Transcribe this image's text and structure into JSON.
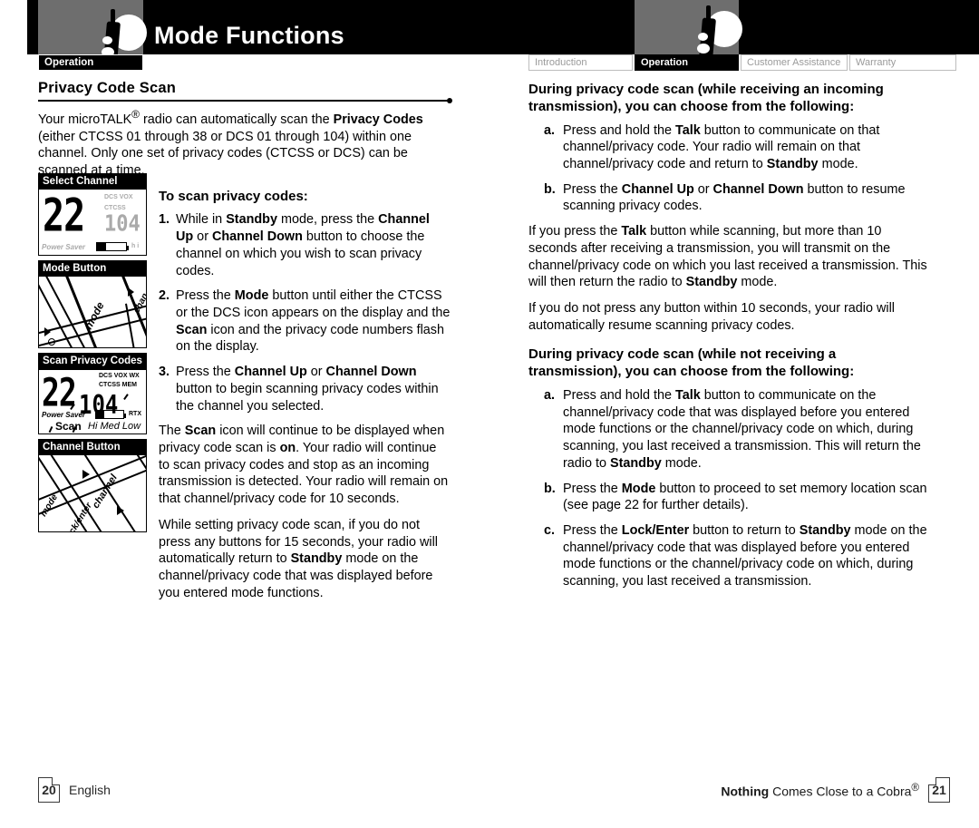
{
  "header": {
    "title": "Mode Functions",
    "left_tab": "Operation",
    "icon": "two-way-radio-icon",
    "right_tabs": [
      {
        "label": "Introduction",
        "active": false
      },
      {
        "label": "Operation",
        "active": true
      },
      {
        "label": "Customer Assistance",
        "active": false
      },
      {
        "label": "Warranty",
        "active": false
      }
    ]
  },
  "left_page": {
    "section_title": "Privacy Code Scan",
    "intro_html": "Your microTALK<sup>®</sup> radio can automatically scan the <b>Privacy Codes</b> (either CTCSS 01 through 38 or DCS 01 through 104) within one channel. Only one set of privacy codes (CTCSS or DCS) can be scanned at a time.",
    "subhead": "To scan privacy codes:",
    "steps": [
      {
        "marker": "1.",
        "html": "While in <b>Standby</b> mode, press the <b>Channel Up</b> or <b>Channel Down</b> button to choose the channel on which you wish to scan privacy codes."
      },
      {
        "marker": "2.",
        "html": "Press the <b>Mode</b> button until either the CTCSS or the DCS icon appears on the display and the <b>Scan</b> icon and the privacy code numbers flash on the display."
      },
      {
        "marker": "3.",
        "html": "Press the <b>Channel Up</b> or <b>Channel Down</b> button to begin scanning privacy codes within the channel you selected."
      }
    ],
    "note1_html": "The <b>Scan</b> icon will continue to be displayed when privacy code scan is <b>on</b>. Your radio will continue to scan privacy codes and stop as an incoming transmission is detected. Your radio will remain on that channel/privacy code for 10 seconds.",
    "note2_html": "While setting privacy code scan, if you do not press any buttons for 15 seconds, your radio will automatically return to <b>Standby</b> mode on the channel/privacy code that was displayed before you entered mode functions."
  },
  "figures": [
    {
      "caption": "Select Channel",
      "type": "lcd",
      "channel": "22",
      "code": "104",
      "indicators": [
        "DCS",
        "VOX",
        "CTCSS"
      ],
      "power_saver_label": "Power Saver"
    },
    {
      "caption": "Mode Button",
      "type": "keypad",
      "button_label": "mode",
      "secondary_label": "chan"
    },
    {
      "caption": "Scan Privacy Codes",
      "type": "lcd",
      "channel": "22",
      "code": "104",
      "indicators": [
        "DCS",
        "VOX",
        "WX",
        "CTCSS",
        "MEM",
        "RTX"
      ],
      "power_saver_label": "Power Saver",
      "scan_label": "Scan",
      "levels": "Hi Med Low"
    },
    {
      "caption": "Channel Button",
      "type": "keypad",
      "button_label": "channel",
      "secondary_label": "mode",
      "tertiary_label": "lock/enter"
    }
  ],
  "right_page": {
    "block1": {
      "heading": "During privacy code scan (while receiving an incoming transmission), you can choose from the following:",
      "items": [
        {
          "marker": "a.",
          "html": "Press and hold the <b>Talk</b> button to communicate on that channel/privacy code. Your radio will remain on that channel/privacy code and return to <b>Standby</b> mode."
        },
        {
          "marker": "b.",
          "html": "Press the <b>Channel Up</b> or <b>Channel Down</b> button to resume scanning privacy codes."
        }
      ]
    },
    "para1_html": "If you press the <b>Talk</b> button while scanning, but more than 10 seconds after receiving a transmission, you will transmit on the channel/privacy code on which you last received a transmission. This will then return the radio to <b>Standby</b> mode.",
    "para2_html": "If you do not press any button within 10 seconds, your radio will automatically resume scanning privacy codes.",
    "block2": {
      "heading": "During privacy code scan (while not receiving a transmission), you can choose from the following:",
      "items": [
        {
          "marker": "a.",
          "html": "Press and hold the <b>Talk</b> button to communicate on the channel/privacy code that was displayed before you entered mode functions or the channel/privacy code on which, during scanning, you last received a transmission. This will return the radio to <b>Standby</b> mode."
        },
        {
          "marker": "b.",
          "html": "Press the <b>Mode</b> button to proceed to set memory location scan (see page 22 for further details)."
        },
        {
          "marker": "c.",
          "html": "Press the <b>Lock/Enter</b> button to return to <b>Standby</b> mode on the channel/privacy code that was displayed before you entered mode functions or the channel/privacy code on which, during scanning, you last received a transmission."
        }
      ]
    }
  },
  "footer": {
    "left_page_number": "20",
    "left_label": "English",
    "right_slogan_html": "<b>Nothing</b> Comes Close to a Cobra<sup>®</sup>",
    "right_page_number": "21"
  }
}
